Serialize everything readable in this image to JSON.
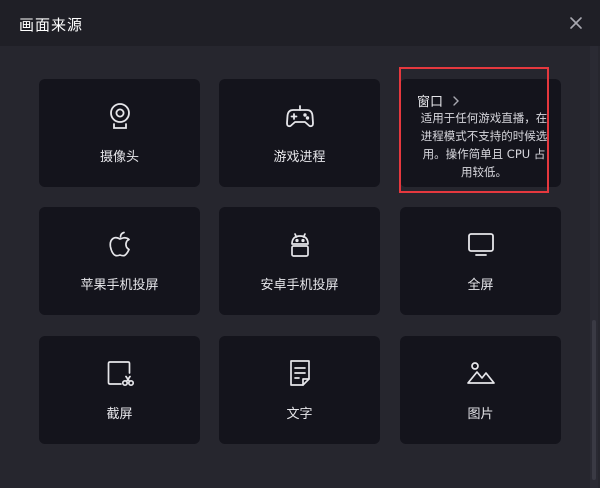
{
  "dialog": {
    "title": "画面来源"
  },
  "tiles": [
    {
      "id": "camera",
      "label": "摄像头",
      "icon": "camera-icon"
    },
    {
      "id": "game",
      "label": "游戏进程",
      "icon": "gamepad-icon"
    },
    {
      "id": "window",
      "label": "窗口",
      "icon": "chevron-right-icon",
      "description": "适用于任何游戏直播，在进程模式不支持的时候选用。操作简单且 CPU 占用较低。"
    },
    {
      "id": "apple",
      "label": "苹果手机投屏",
      "icon": "apple-icon"
    },
    {
      "id": "android",
      "label": "安卓手机投屏",
      "icon": "android-icon"
    },
    {
      "id": "fullscreen",
      "label": "全屏",
      "icon": "monitor-icon"
    },
    {
      "id": "screenshot",
      "label": "截屏",
      "icon": "crop-screenshot-icon"
    },
    {
      "id": "text",
      "label": "文字",
      "icon": "document-text-icon"
    },
    {
      "id": "image",
      "label": "图片",
      "icon": "image-icon"
    }
  ],
  "colors": {
    "background": "#26262e",
    "titlebar": "#1f1f26",
    "tile": "#14141c",
    "highlight": "#e5383e",
    "text": "#e6e6ea"
  }
}
